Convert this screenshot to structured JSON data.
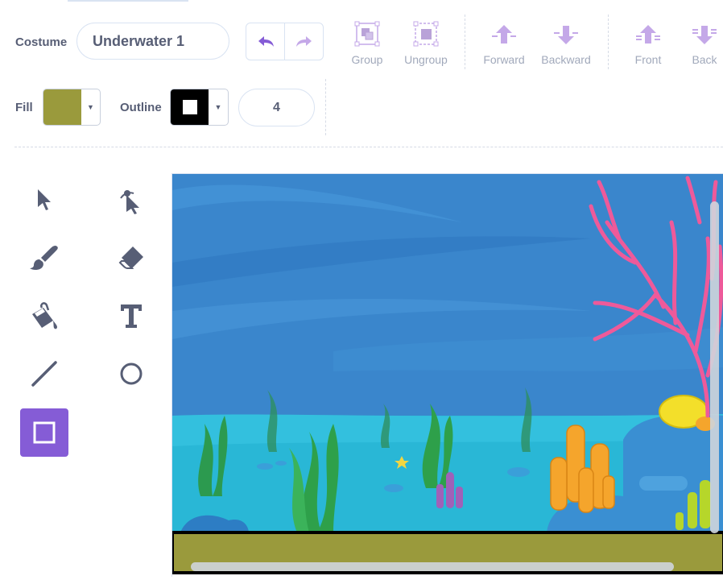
{
  "costume": {
    "label": "Costume",
    "name": "Underwater 1"
  },
  "toolbar": {
    "group": "Group",
    "ungroup": "Ungroup",
    "forward": "Forward",
    "backward": "Backward",
    "front": "Front",
    "back": "Back"
  },
  "style": {
    "fill_label": "Fill",
    "fill_color": "#9a9a3c",
    "outline_label": "Outline",
    "outline_color": "#000000",
    "outline_width": "4"
  },
  "tools": [
    "select",
    "reshape",
    "brush",
    "eraser",
    "fill",
    "text",
    "line",
    "circle",
    "rectangle"
  ],
  "active_tool": "rectangle",
  "colors": {
    "accent": "#855cd6",
    "text": "#575e75",
    "disabled": "#a1a9bb",
    "layer_icon": "#c4a8e8"
  }
}
